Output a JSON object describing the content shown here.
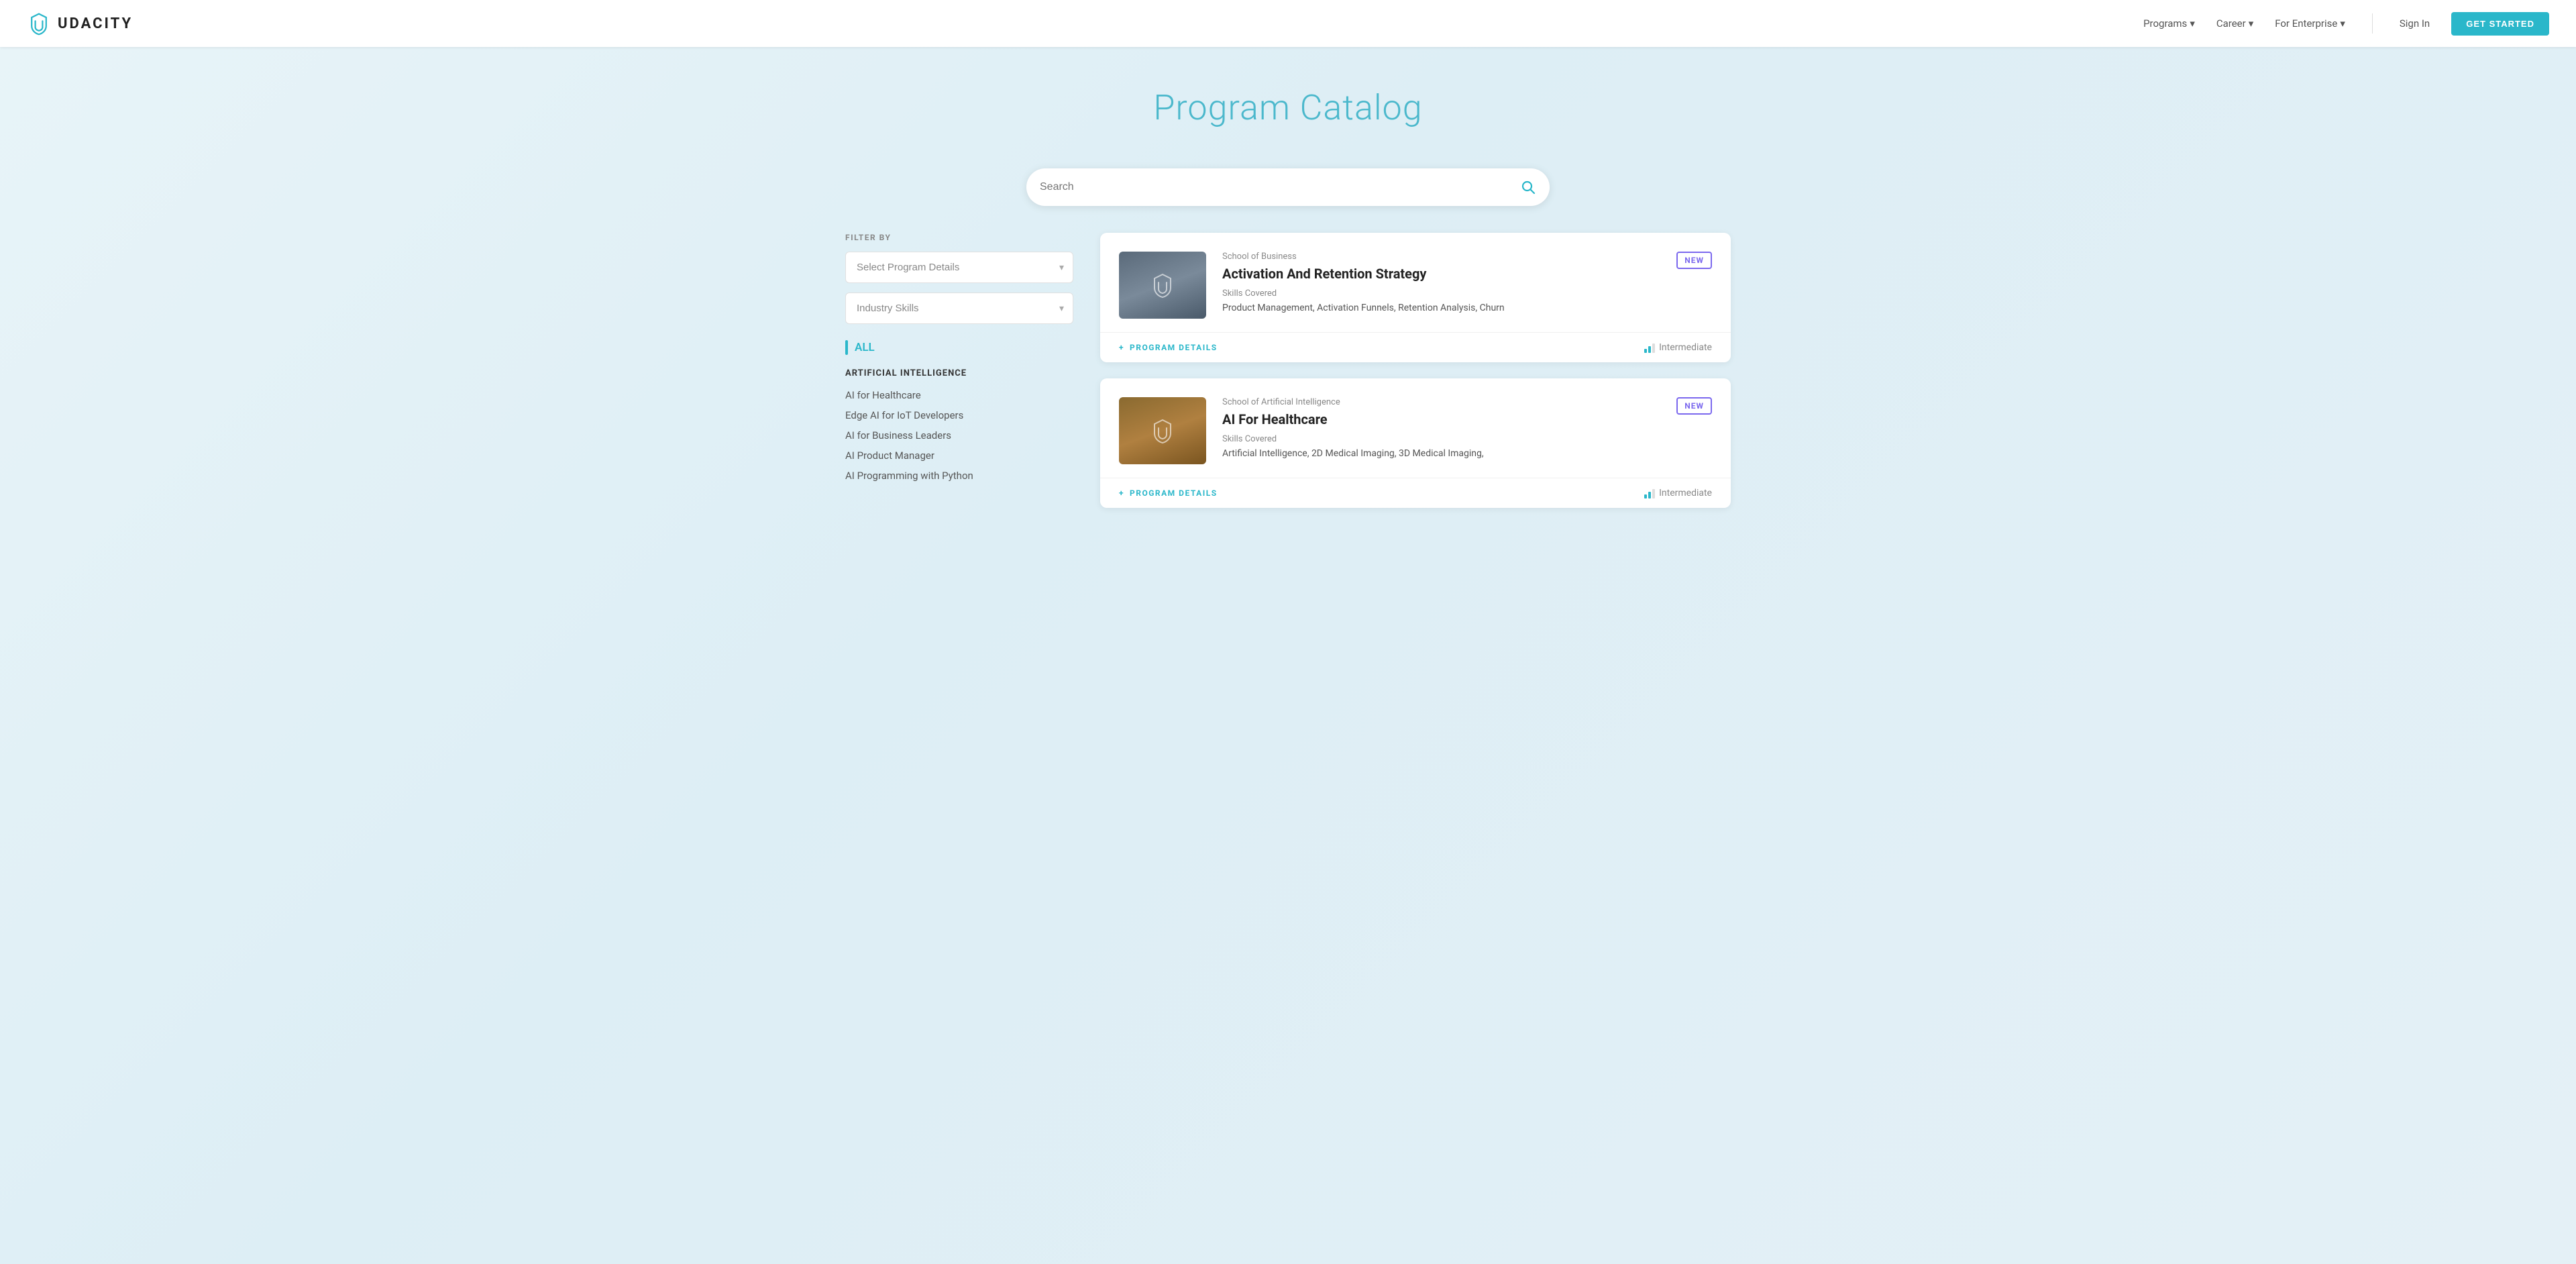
{
  "nav": {
    "logo_text": "UDACITY",
    "links": [
      {
        "label": "Programs",
        "has_dropdown": true
      },
      {
        "label": "Career",
        "has_dropdown": true
      },
      {
        "label": "For Enterprise",
        "has_dropdown": true
      }
    ],
    "signin_label": "Sign In",
    "cta_label": "GET STARTED"
  },
  "hero": {
    "title": "Program Catalog"
  },
  "search": {
    "placeholder": "Search"
  },
  "sidebar": {
    "filter_label": "FILTER BY",
    "select_program_details": "Select Program Details",
    "select_industry_skills": "Industry Skills",
    "all_label": "ALL",
    "categories": [
      {
        "name": "ARTIFICIAL INTELLIGENCE",
        "items": [
          "AI for Healthcare",
          "Edge AI for IoT Developers",
          "AI for Business Leaders",
          "AI Product Manager",
          "AI Programming with Python"
        ]
      }
    ]
  },
  "cards": [
    {
      "school": "School of Business",
      "title": "Activation And Retention Strategy",
      "is_new": true,
      "new_label": "NEW",
      "skills_label": "Skills Covered",
      "skills": "Product Management, Activation Funnels, Retention Analysis, Churn",
      "program_details_label": "PROGRAM DETAILS",
      "level": "Intermediate",
      "thumb_type": "business"
    },
    {
      "school": "School of Artificial Intelligence",
      "title": "AI For Healthcare",
      "is_new": true,
      "new_label": "NEW",
      "skills_label": "Skills Covered",
      "skills": "Artificial Intelligence, 2D Medical Imaging, 3D Medical Imaging,",
      "program_details_label": "PROGRAM DETAILS",
      "level": "Intermediate",
      "thumb_type": "ai"
    }
  ]
}
